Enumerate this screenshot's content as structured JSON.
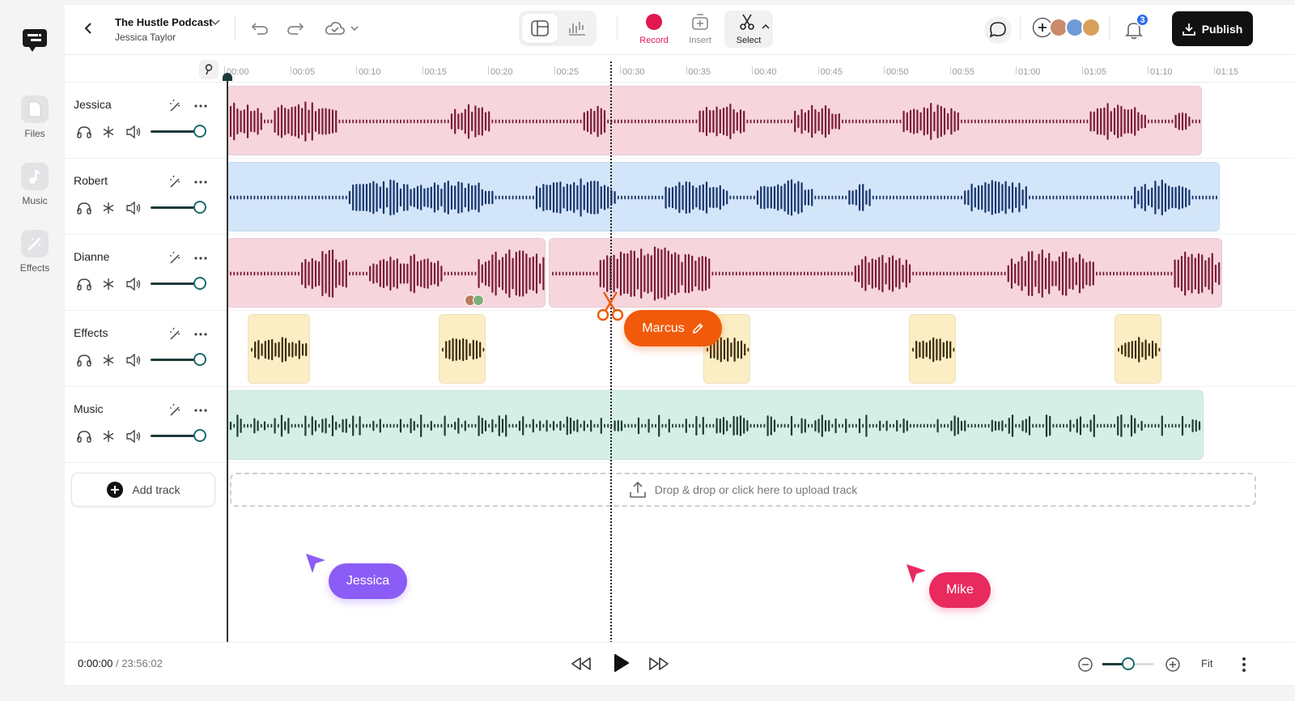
{
  "sidebar": {
    "items": [
      {
        "label": "Files",
        "icon": "file-icon"
      },
      {
        "label": "Music",
        "icon": "music-note-icon"
      },
      {
        "label": "Effects",
        "icon": "magic-wand-icon"
      }
    ]
  },
  "header": {
    "title": "The Hustle Podcast",
    "subtitle": "Jessica Taylor",
    "tools": [
      {
        "label": "Record",
        "color": "#e0184f"
      },
      {
        "label": "Insert"
      },
      {
        "label": "Select"
      }
    ],
    "notification_count": "3",
    "publish_label": "Publish"
  },
  "ruler": {
    "ticks": [
      "00:00",
      "00:05",
      "00:10",
      "00:15",
      "00:20",
      "00:25",
      "00:30",
      "00:35",
      "00:40",
      "00:45",
      "00:50",
      "00:55",
      "01:00",
      "01:05",
      "01:10",
      "01:15"
    ]
  },
  "tracks": [
    {
      "name": "Jessica",
      "color": "#f6d5dc",
      "wave": "#7a1a36"
    },
    {
      "name": "Robert",
      "color": "#d3e5f9",
      "wave": "#17336b"
    },
    {
      "name": "Dianne",
      "color": "#f6d5dc",
      "wave": "#7a1a36"
    },
    {
      "name": "Effects",
      "color": "#fbeec4",
      "wave": "#3a2a0a"
    },
    {
      "name": "Music",
      "color": "#d6efe6",
      "wave": "#1d3a33"
    }
  ],
  "add_track_label": "Add track",
  "dropzone_label": "Drop & drop or click here to upload track",
  "collaborators": {
    "marcus": {
      "label": "Marcus",
      "color": "#f15a0a"
    },
    "jessica": {
      "label": "Jessica",
      "color": "#8b5cf6"
    },
    "mike": {
      "label": "Mike",
      "color": "#e82a5f"
    }
  },
  "transport": {
    "current_time": "0:00:00",
    "total_time": "/ 23:56:02",
    "fit_label": "Fit"
  }
}
